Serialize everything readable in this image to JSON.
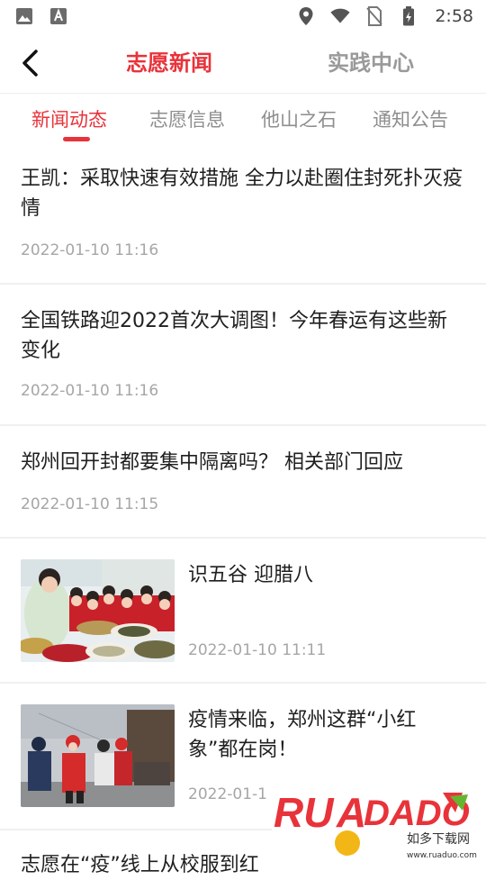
{
  "status_bar": {
    "time": "2:58",
    "left_icons": [
      "image-icon",
      "text-a-icon"
    ],
    "right_icons": [
      "location-icon",
      "wifi-icon",
      "no-sim-icon",
      "battery-charging-icon"
    ]
  },
  "header": {
    "tabs": [
      {
        "label": "志愿新闻",
        "active": true
      },
      {
        "label": "实践中心",
        "active": false
      }
    ]
  },
  "categories": [
    {
      "label": "新闻动态",
      "active": true
    },
    {
      "label": "志愿信息",
      "active": false
    },
    {
      "label": "他山之石",
      "active": false
    },
    {
      "label": "通知公告",
      "active": false
    }
  ],
  "news": [
    {
      "title": "王凯：采取快速有效措施 全力以赴圈住封死扑灭疫情",
      "time": "2022-01-10 11:16",
      "has_image": false
    },
    {
      "title": "全国铁路迎2022首次大调图！今年春运有这些新变化",
      "time": "2022-01-10 11:16",
      "has_image": false
    },
    {
      "title": "郑州回开封都要集中隔离吗？ 相关部门回应",
      "time": "2022-01-10 11:15",
      "has_image": false
    },
    {
      "title": "识五谷 迎腊八",
      "time": "2022-01-10 11:11",
      "has_image": true
    },
    {
      "title": "疫情来临，郑州这群“小红象”都在岗！",
      "time": "2022-01-1",
      "has_image": true
    },
    {
      "title": "志愿在“疫”线上从校服到红",
      "time": "",
      "has_image": false
    }
  ],
  "watermark": {
    "logo_text": "RUANDADO",
    "tagline": "如多下载网",
    "url": "www.ruaduo.com"
  },
  "colors": {
    "accent": "#e8333a",
    "inactive_text": "#9a9a9a",
    "time_text": "#a6a6a6",
    "divider": "#f0f0f0"
  }
}
